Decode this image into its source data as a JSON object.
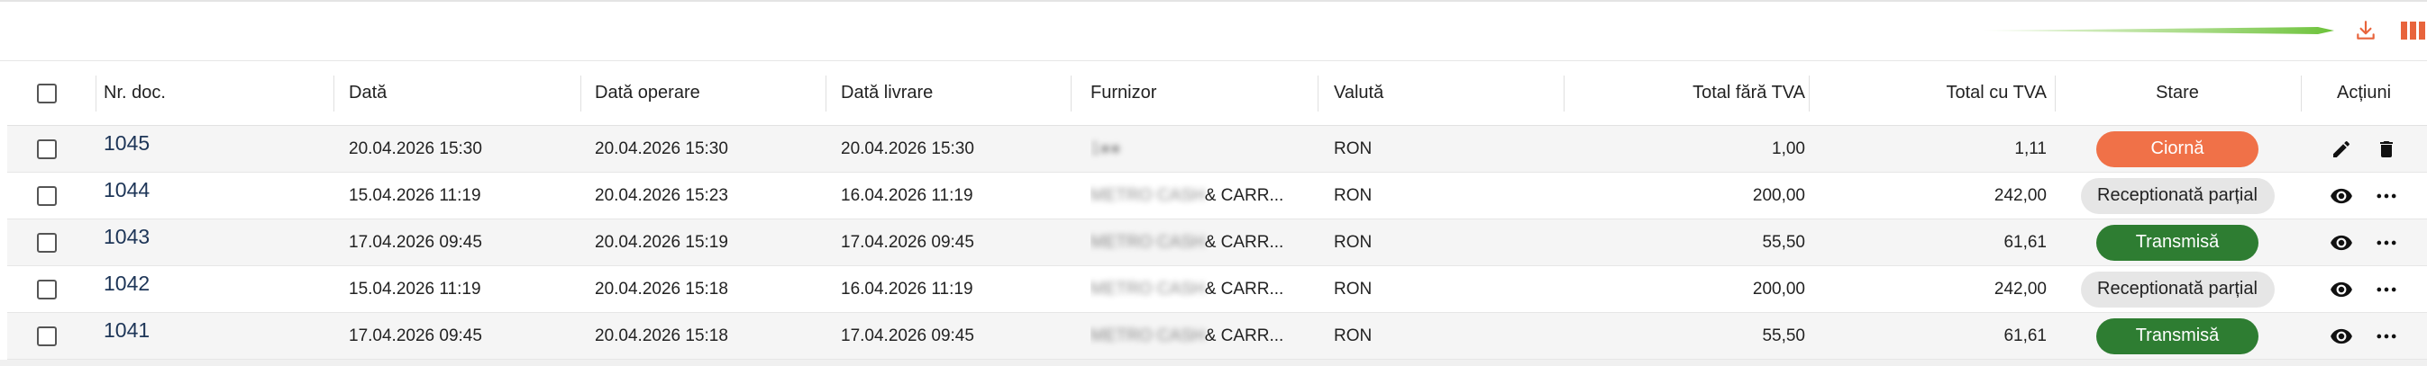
{
  "toolbar": {
    "download_icon": "download-icon",
    "columns_icon": "columns-icon",
    "accent_color": "#e8643c"
  },
  "headers": {
    "nr": "Nr. doc.",
    "data": "Dată",
    "data_operare": "Dată operare",
    "data_livrare": "Dată livrare",
    "furnizor": "Furnizor",
    "valuta": "Valută",
    "total_fara_tva": "Total fără TVA",
    "total_cu_tva": "Total cu TVA",
    "stare": "Stare",
    "actiuni": "Acțiuni"
  },
  "rows": [
    {
      "nr": "1045",
      "data": "20.04.2026 15:30",
      "data_operare": "20.04.2026 15:30",
      "data_livrare": "20.04.2026 15:30",
      "furnizor_hidden": "1●●",
      "furnizor_visible": "",
      "valuta": "RON",
      "total_fara_tva": "1,00",
      "total_cu_tva": "1,11",
      "stare": "Ciornă",
      "stare_kind": "ciorna"
    },
    {
      "nr": "1044",
      "data": "15.04.2026 11:19",
      "data_operare": "20.04.2026 15:23",
      "data_livrare": "16.04.2026 11:19",
      "furnizor_hidden": "METRO CASH",
      "furnizor_visible": " & CARR...",
      "valuta": "RON",
      "total_fara_tva": "200,00",
      "total_cu_tva": "242,00",
      "stare": "Receptionată parțial",
      "stare_kind": "receptionata"
    },
    {
      "nr": "1043",
      "data": "17.04.2026 09:45",
      "data_operare": "20.04.2026 15:19",
      "data_livrare": "17.04.2026 09:45",
      "furnizor_hidden": "METRO CASH",
      "furnizor_visible": " & CARR...",
      "valuta": "RON",
      "total_fara_tva": "55,50",
      "total_cu_tva": "61,61",
      "stare": "Transmisă",
      "stare_kind": "transmisa"
    },
    {
      "nr": "1042",
      "data": "15.04.2026 11:19",
      "data_operare": "20.04.2026 15:18",
      "data_livrare": "16.04.2026 11:19",
      "furnizor_hidden": "METRO CASH",
      "furnizor_visible": " & CARR...",
      "valuta": "RON",
      "total_fara_tva": "200,00",
      "total_cu_tva": "242,00",
      "stare": "Receptionată parțial",
      "stare_kind": "receptionata"
    },
    {
      "nr": "1041",
      "data": "17.04.2026 09:45",
      "data_operare": "20.04.2026 15:18",
      "data_livrare": "17.04.2026 09:45",
      "furnizor_hidden": "METRO CASH",
      "furnizor_visible": " & CARR...",
      "valuta": "RON",
      "total_fara_tva": "55,50",
      "total_cu_tva": "61,61",
      "stare": "Transmisă",
      "stare_kind": "transmisa"
    }
  ]
}
